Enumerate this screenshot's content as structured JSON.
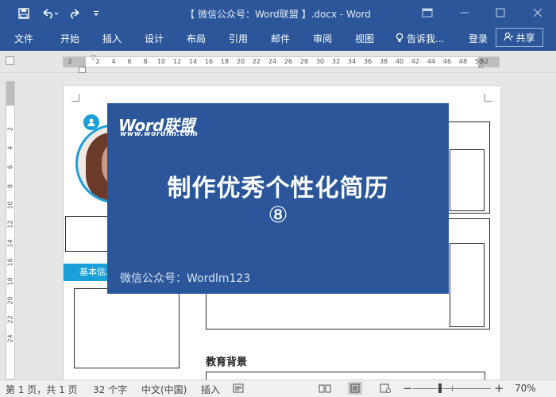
{
  "window": {
    "title": "【 微信公众号：Word联盟 】.docx - Word"
  },
  "quick_access": {
    "save_icon": "save-icon",
    "undo_icon": "undo-icon",
    "redo_icon": "redo-icon",
    "customize_icon": "customize-qat-icon"
  },
  "ribbon": {
    "tabs": [
      "文件",
      "开始",
      "插入",
      "设计",
      "布局",
      "引用",
      "邮件",
      "审阅",
      "视图"
    ],
    "tell_me": "告诉我...",
    "login": "登录",
    "share": "共享"
  },
  "ruler": {
    "h_ticks": [
      "2",
      "2",
      "4",
      "6",
      "8",
      "10",
      "12",
      "14",
      "16",
      "18",
      "20",
      "22",
      "24",
      "26",
      "28",
      "30",
      "32",
      "34",
      "36",
      "38",
      "40",
      "42",
      "44",
      "46",
      "48",
      "50",
      "52"
    ],
    "v_ticks": [
      "2",
      "4",
      "6",
      "8",
      "10",
      "12",
      "14",
      "16",
      "18",
      "20",
      "22",
      "24"
    ]
  },
  "document": {
    "basic_info_label": "基本信息",
    "education_heading": "教育背景"
  },
  "banner": {
    "brand": "Word联盟",
    "brand_url": "www.wordlm.com",
    "headline": "制作优秀个性化简历",
    "number": "⑧",
    "footer": "微信公众号：Wordlm123"
  },
  "status": {
    "page": "第 1 页，共 1 页",
    "words": "32 个字",
    "language": "中文(中国)",
    "mode": "插入",
    "zoom": "70%"
  },
  "colors": {
    "word_blue": "#2b579a",
    "accent_cyan": "#1aa0d8"
  }
}
